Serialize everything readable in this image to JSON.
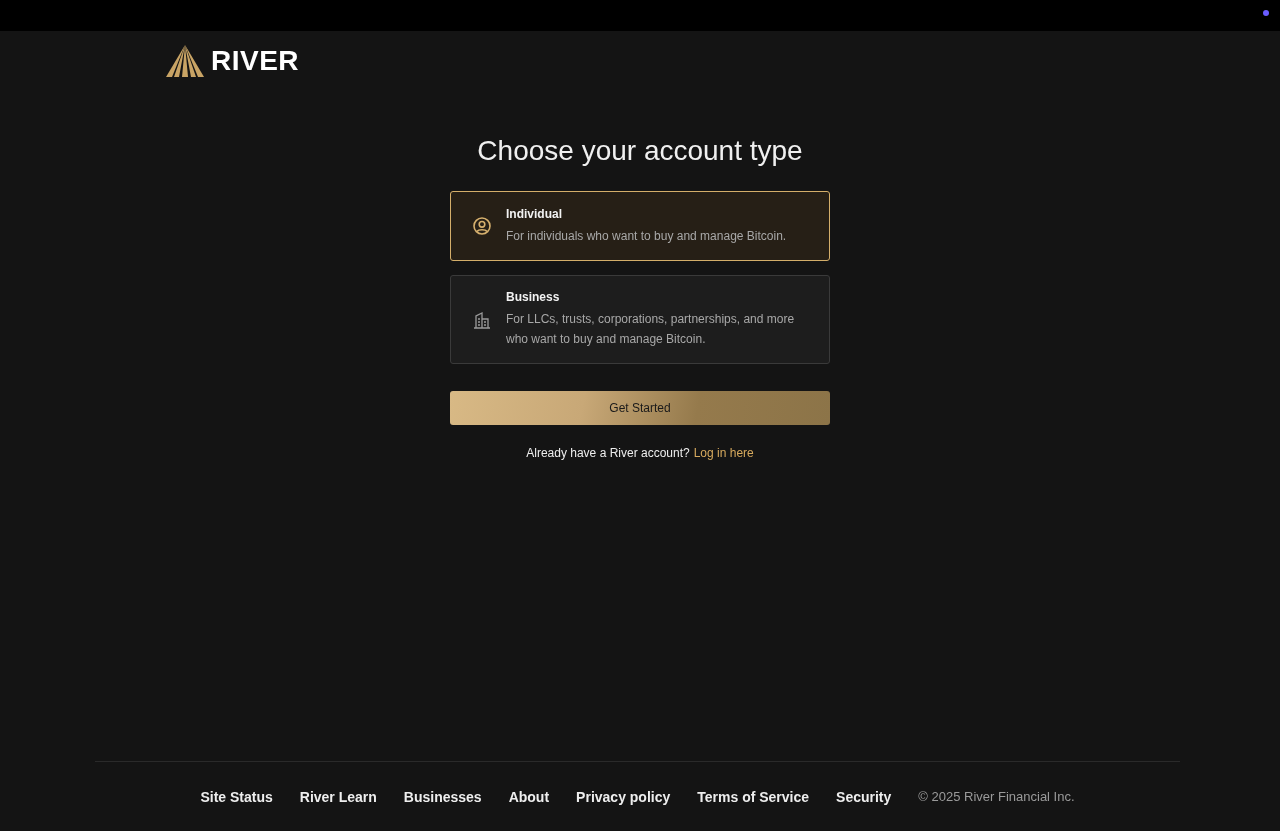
{
  "header": {
    "logo_text": "RIVER"
  },
  "title": "Choose your account type",
  "account_types": [
    {
      "kind": "person",
      "title": "Individual",
      "description": "For individuals who want to buy and manage Bitcoin.",
      "selected": true
    },
    {
      "kind": "building",
      "title": "Business",
      "description": "For LLCs, trusts, corporations, partnerships, and more who want to buy and manage Bitcoin.",
      "selected": false
    }
  ],
  "primary_button": "Get Started",
  "login_prompt": {
    "text": "Already have a River account?",
    "link": "Log in here"
  },
  "footer": {
    "links": [
      "Site Status",
      "River Learn",
      "Businesses",
      "About",
      "Privacy policy",
      "Terms of Service",
      "Security"
    ],
    "copyright": "© 2025 River Financial Inc."
  }
}
